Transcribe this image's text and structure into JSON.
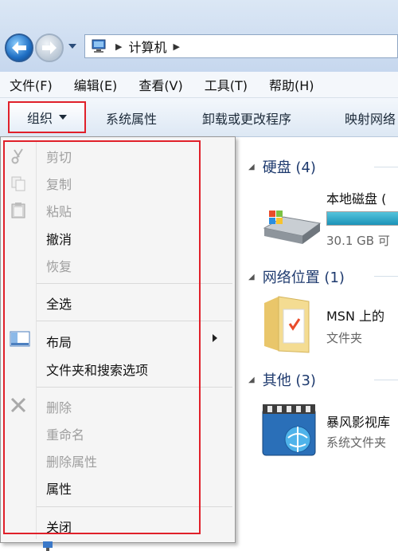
{
  "address": {
    "breadcrumb_location": "计算机"
  },
  "menubar": {
    "items": [
      "文件(F)",
      "编辑(E)",
      "查看(V)",
      "工具(T)",
      "帮助(H)"
    ]
  },
  "commandbar": {
    "organize": "组织",
    "system_properties": "系统属性",
    "uninstall": "卸载或更改程序",
    "map_network": "映射网络"
  },
  "organize_menu": {
    "cut": "剪切",
    "copy": "复制",
    "paste": "粘贴",
    "undo": "撤消",
    "redo": "恢复",
    "select_all": "全选",
    "layout": "布局",
    "folder_options": "文件夹和搜索选项",
    "delete": "删除",
    "rename": "重命名",
    "remove_properties": "删除属性",
    "properties": "属性",
    "close": "关闭"
  },
  "content": {
    "hard_disks": {
      "header": "硬盘 (4)",
      "item_title": "本地磁盘 (",
      "item_sub": "30.1 GB 可",
      "usage_fraction": 1.0
    },
    "network": {
      "header": "网络位置 (1)",
      "item_title": "MSN 上的",
      "item_sub": "文件夹"
    },
    "other": {
      "header": "其他 (3)",
      "item_title": "暴风影视库",
      "item_sub": "系统文件夹"
    }
  },
  "colors": {
    "highlight_frame": "#e0202a",
    "group_header": "#1e3a6e",
    "disabled_text": "#9e9e9e"
  }
}
